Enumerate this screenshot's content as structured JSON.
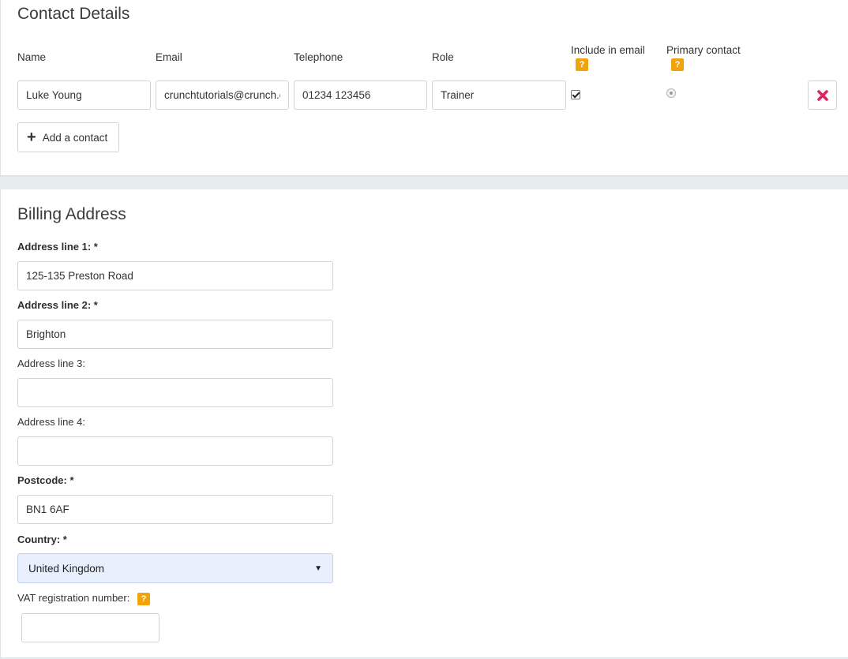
{
  "contact": {
    "title": "Contact Details",
    "headers": {
      "name": "Name",
      "email": "Email",
      "telephone": "Telephone",
      "role": "Role",
      "include_in_email": "Include in email",
      "primary_contact": "Primary contact"
    },
    "help_glyph": "?",
    "row": {
      "name": "Luke Young",
      "email": "crunchtutorials@crunch.c",
      "telephone": "01234 123456",
      "role": "Trainer",
      "include_in_email": true,
      "primary_contact": true
    },
    "add_label": "Add a contact",
    "add_glyph": "+"
  },
  "billing": {
    "title": "Billing Address",
    "address1": {
      "label": "Address line 1: *",
      "value": "125-135 Preston Road"
    },
    "address2": {
      "label": "Address line 2: *",
      "value": "Brighton"
    },
    "address3": {
      "label": "Address line 3:",
      "value": ""
    },
    "address4": {
      "label": "Address line 4:",
      "value": ""
    },
    "postcode": {
      "label": "Postcode: *",
      "value": "BN1 6AF"
    },
    "country": {
      "label": "Country: *",
      "value": "United Kingdom"
    },
    "vat": {
      "label": "VAT registration number:",
      "value": ""
    }
  },
  "icons": {
    "help": "help-icon",
    "delete": "close-icon",
    "add": "plus-icon",
    "dropdown": "chevron-down-icon"
  },
  "colors": {
    "help_badge": "#f0a30a",
    "delete_icon": "#e0245e",
    "select_bg": "#e8f0fe"
  }
}
